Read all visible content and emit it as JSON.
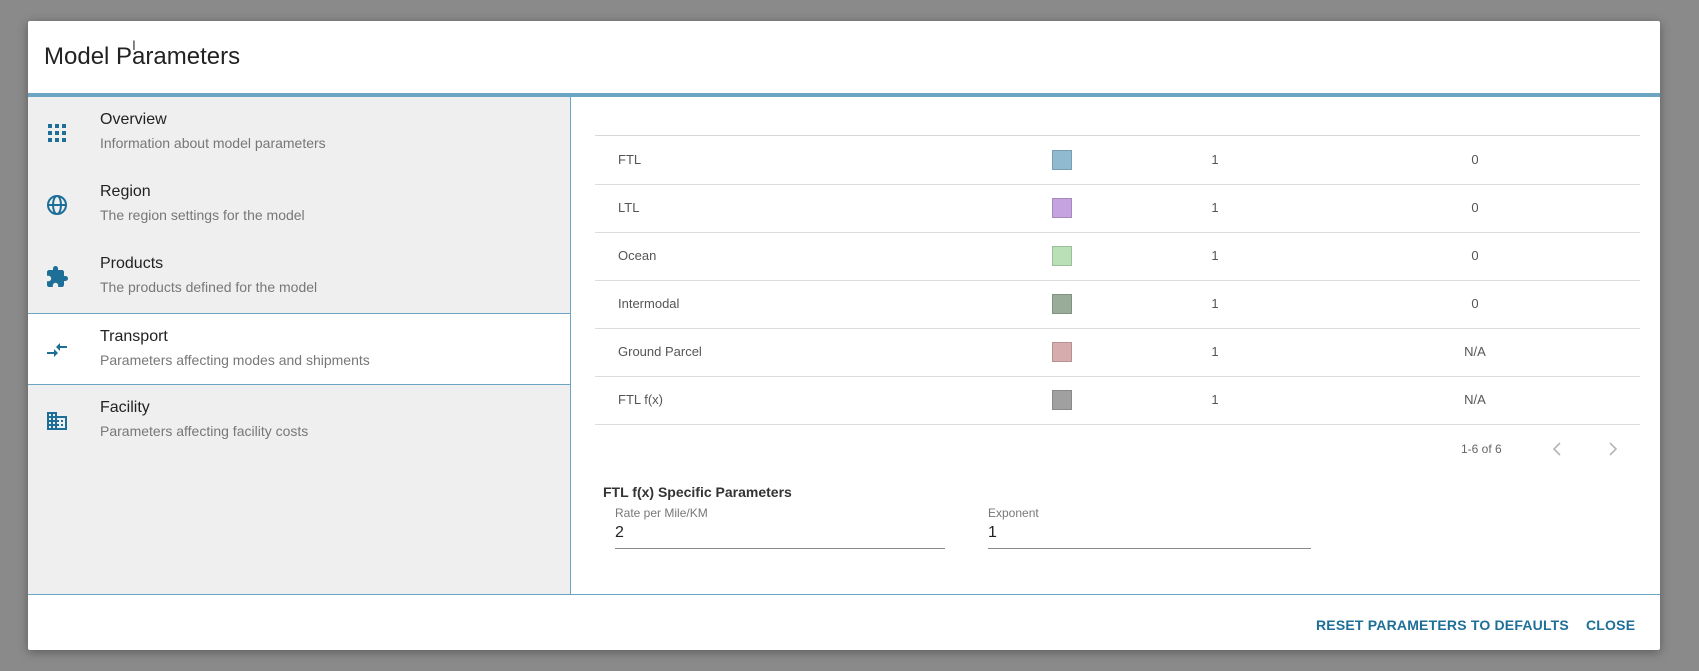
{
  "dialog": {
    "title": "Model Parameters"
  },
  "sidebar": {
    "items": [
      {
        "label": "Overview",
        "desc": "Information about model parameters",
        "icon": "apps-grid-icon"
      },
      {
        "label": "Region",
        "desc": "The region settings for the model",
        "icon": "globe-icon"
      },
      {
        "label": "Products",
        "desc": "The products defined for the model",
        "icon": "puzzle-icon"
      },
      {
        "label": "Transport",
        "desc": "Parameters affecting modes and shipments",
        "icon": "compare-arrows-icon",
        "active": true
      },
      {
        "label": "Facility",
        "desc": "Parameters affecting facility costs",
        "icon": "building-icon"
      }
    ]
  },
  "modes_table": {
    "rows": [
      {
        "name": "FTL",
        "color": "#8fbad0",
        "v1": "1",
        "v2": "0"
      },
      {
        "name": "LTL",
        "color": "#c4a3e0",
        "v1": "1",
        "v2": "0"
      },
      {
        "name": "Ocean",
        "color": "#b9e0b7",
        "v1": "1",
        "v2": "0"
      },
      {
        "name": "Intermodal",
        "color": "#98ac99",
        "v1": "1",
        "v2": "0"
      },
      {
        "name": "Ground Parcel",
        "color": "#d6acac",
        "v1": "1",
        "v2": "N/A"
      },
      {
        "name": "FTL f(x)",
        "color": "#a0a0a0",
        "v1": "1",
        "v2": "N/A"
      }
    ],
    "pager": {
      "range": "1-6 of 6"
    }
  },
  "ftl_fx": {
    "title": "FTL f(x) Specific Parameters",
    "rate_label": "Rate per Mile/KM",
    "rate_value": "2",
    "exponent_label": "Exponent",
    "exponent_value": "1"
  },
  "footer": {
    "reset_label": "RESET PARAMETERS TO DEFAULTS",
    "close_label": "CLOSE"
  },
  "colors": {
    "accent": "#1e6f98",
    "rule": "#6aa6c4"
  }
}
